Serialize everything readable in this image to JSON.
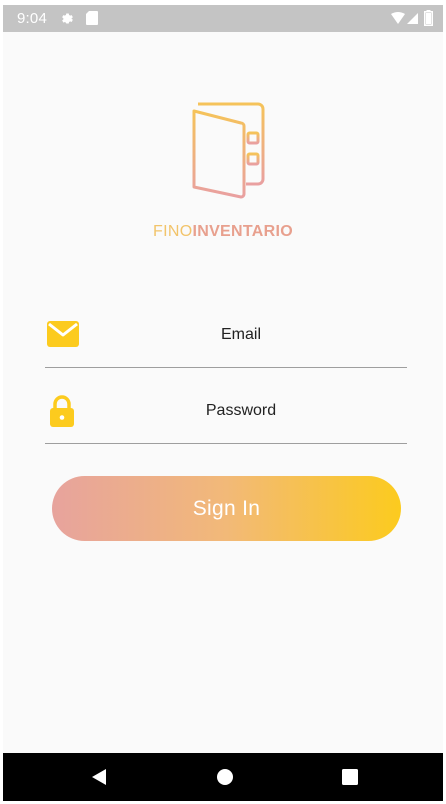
{
  "status_bar": {
    "time": "9:04",
    "icons": [
      "gear-icon",
      "sd-card-icon",
      "wifi-icon",
      "signal-icon",
      "battery-icon"
    ]
  },
  "logo": {
    "icon": "wallet-icon",
    "name_light": "FINO",
    "name_bold": "INVENTARIO"
  },
  "form": {
    "email": {
      "icon": "mail-icon",
      "placeholder": "Email",
      "value": ""
    },
    "password": {
      "icon": "lock-icon",
      "placeholder": "Password",
      "value": ""
    },
    "submit_label": "Sign In"
  },
  "nav_bar": {
    "icons": [
      "back-icon",
      "home-icon",
      "recents-icon"
    ]
  },
  "colors": {
    "accent_yellow": "#fccb1e",
    "accent_pink": "#e7a39d",
    "status_bar": "#c4c4c4",
    "nav_bar": "#000000"
  }
}
